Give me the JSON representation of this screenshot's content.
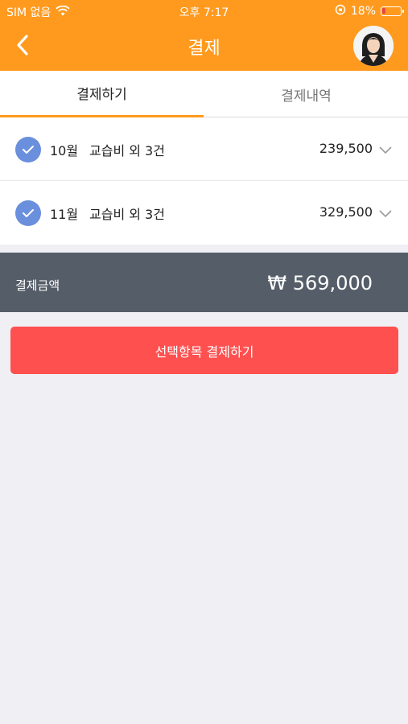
{
  "status": {
    "carrier": "SIM 없음",
    "time": "오후 7:17",
    "battery": "18%",
    "battery_color": "#E84545"
  },
  "nav": {
    "title": "결제",
    "back_icon": "chevron-left-icon",
    "avatar_icon": "avatar"
  },
  "tabs": {
    "pay": "결제하기",
    "history": "결제내역"
  },
  "items": [
    {
      "month": "10월",
      "desc": "교습비 외 3건",
      "amount": "239,500",
      "checked": true
    },
    {
      "month": "11월",
      "desc": "교습비 외 3건",
      "amount": "329,500",
      "checked": true
    }
  ],
  "total": {
    "label": "결제금액",
    "value": "₩ 569,000"
  },
  "pay_button": {
    "label": "선택항목 결제하기"
  },
  "colors": {
    "header": "#FF9A1E",
    "check": "#6A8FDD",
    "total_bar": "#555E68",
    "pay_button": "#FF5050",
    "background": "#EFEFF4"
  }
}
